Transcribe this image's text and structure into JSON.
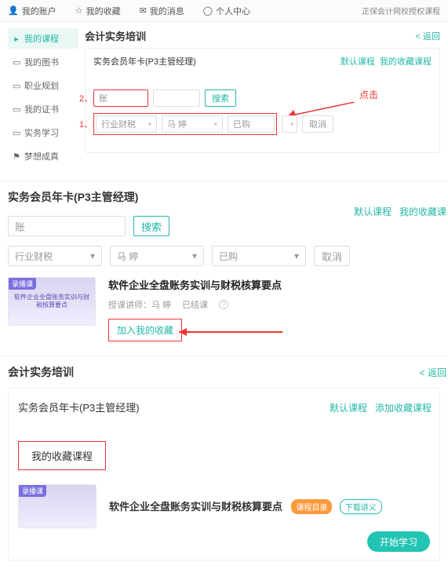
{
  "topnav": {
    "account": "我的账户",
    "favorites": "我的收藏",
    "messages": "我的消息",
    "profile": "个人中心",
    "right_note": "正保会计网校授权课程"
  },
  "sidebar": {
    "items": [
      {
        "label": "我的课程"
      },
      {
        "label": "我的图书"
      },
      {
        "label": "职业规划"
      },
      {
        "label": "我的证书"
      },
      {
        "label": "实务学习"
      },
      {
        "label": "梦想成真"
      }
    ]
  },
  "sec1": {
    "title": "会计实务培训",
    "back": "< 返回",
    "subtitle": "实务会员年卡(P3主管经理)",
    "link_default": "默认课程",
    "link_fav": "我的收藏课程",
    "click_label": "点击",
    "num1": "1、",
    "num2": "2、",
    "search_input": "账",
    "search_btn": "搜索",
    "filter1": "行业财税",
    "filter2": "马 婷",
    "filter3": "已购",
    "cancel": "取消"
  },
  "sec2": {
    "title": "实务会员年卡(P3主管经理)",
    "link_default": "默认课程",
    "link_fav": "我的收藏课",
    "search_input": "账",
    "search_btn": "搜索",
    "filter1": "行业财税",
    "filter2": "马 婷",
    "filter3": "已购",
    "cancel": "取消",
    "thumb_tag": "录播课",
    "thumb_text": "软件企业全盘账务实训与财税核算要点",
    "course_title": "软件企业全盘账务实训与财税核算要点",
    "teacher_label": "授课讲师：",
    "teacher": "马 婷",
    "status": "已结课",
    "fav_btn": "加入我的收藏"
  },
  "sec3": {
    "title": "会计实务培训",
    "back": "< 返回",
    "subtitle": "实务会员年卡(P3主管经理)",
    "link_default": "默认课程",
    "link_add": "添加收藏课程",
    "tab": "我的收藏课程",
    "thumb_tag": "录播课",
    "course_title": "软件企业全盘账务实训与财税核算要点",
    "badge1": "课程目录",
    "badge2": "下载讲义",
    "start": "开始学习"
  }
}
